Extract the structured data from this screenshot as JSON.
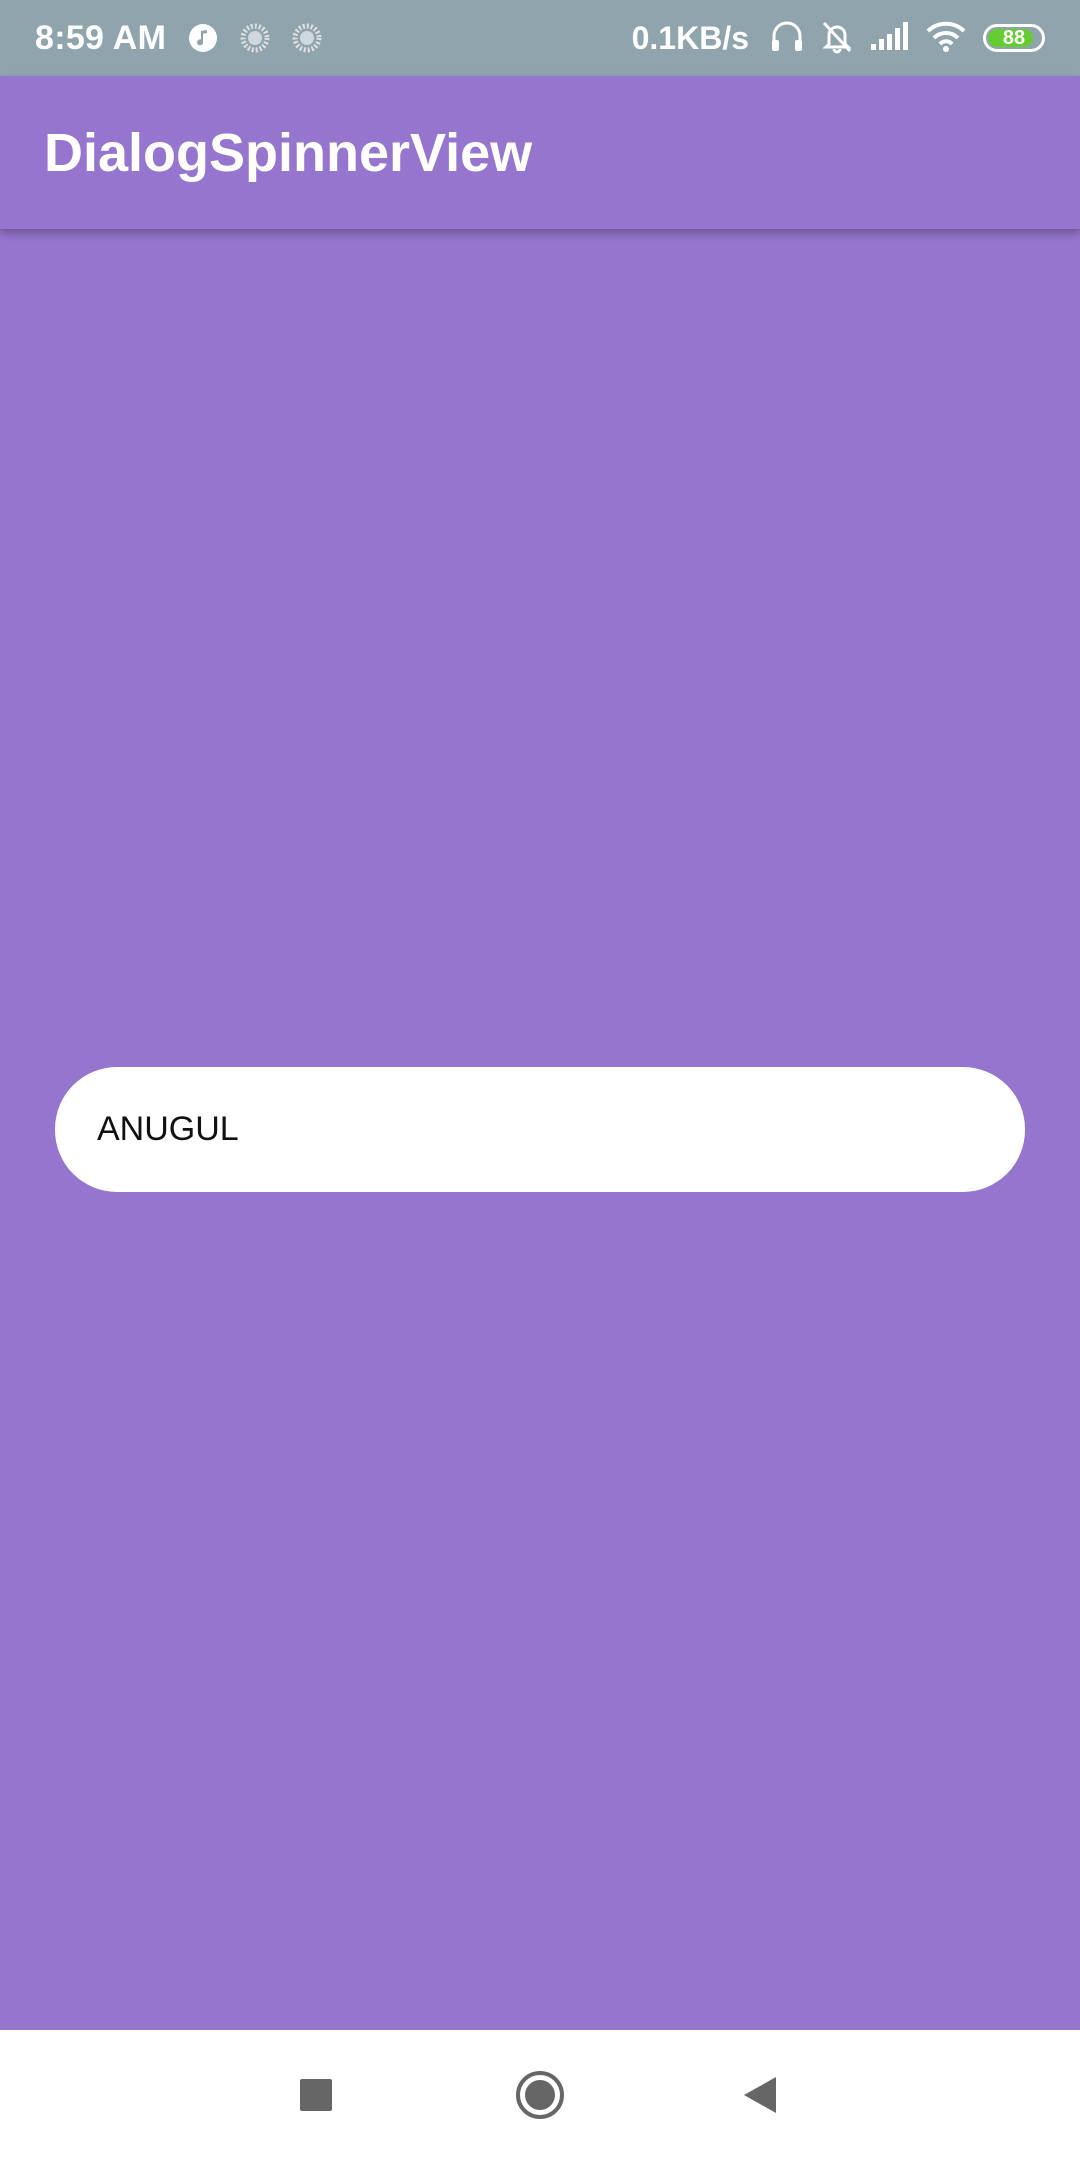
{
  "status_bar": {
    "time": "8:59 AM",
    "net_speed": "0.1KB/s",
    "battery_level": "88",
    "battery_fraction": 0.88,
    "battery_color": "#66cc33",
    "icons": [
      "music-note-icon",
      "loading-icon",
      "loading-icon",
      "headphones-icon",
      "bell-muted-icon",
      "cell-signal-icon",
      "wifi-icon",
      "battery-icon"
    ]
  },
  "app_bar": {
    "title": "DialogSpinnerView",
    "color": "#9575cd"
  },
  "spinner": {
    "selected_value": "ANUGUL"
  },
  "nav_bar": {
    "buttons": [
      "recents-square-icon",
      "home-circle-icon",
      "back-triangle-icon"
    ]
  }
}
